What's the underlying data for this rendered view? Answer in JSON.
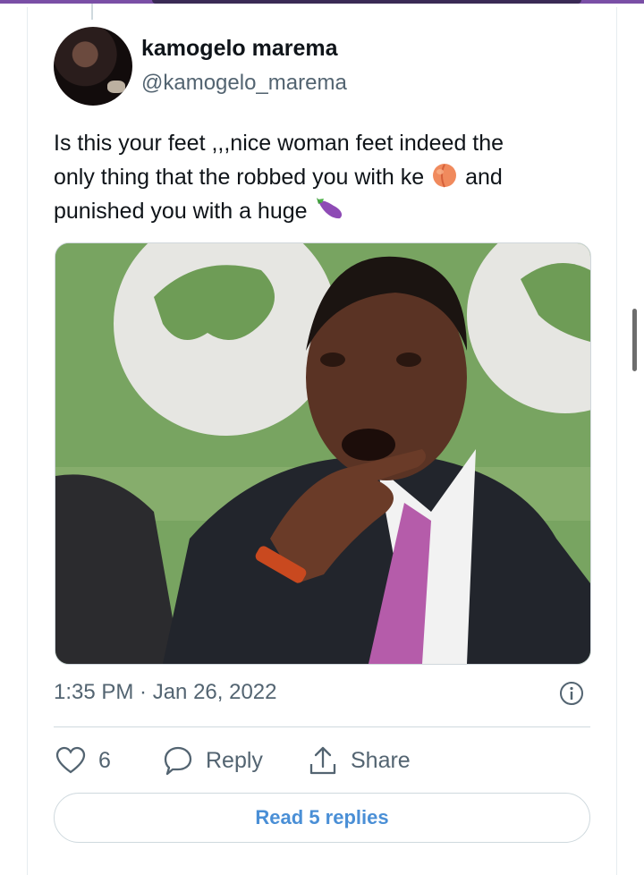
{
  "author": {
    "display_name": "kamogelo marema",
    "handle": "@kamogelo_marema"
  },
  "tweet": {
    "line1": "Is this your feet ,,,nice woman feet indeed the",
    "line2_a": "only thing that the robbed you with ke",
    "line2_b": "and",
    "line3_a": "punished you with a huge",
    "emoji_1": "peach-emoji",
    "emoji_2": "eggplant-emoji"
  },
  "timestamp": "1:35 PM · Jan 26, 2022",
  "actions": {
    "like_count": "6",
    "reply_label": "Reply",
    "share_label": "Share"
  },
  "read_replies_label": "Read 5 replies",
  "colors": {
    "accent": "#4a8fd6",
    "muted_text": "#536471",
    "top_bar": "#7a4fa6"
  }
}
